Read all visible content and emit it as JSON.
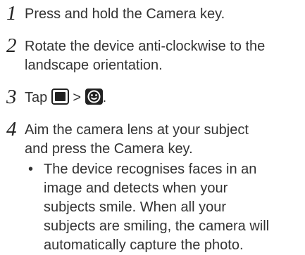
{
  "steps": [
    {
      "number": "1",
      "lines": [
        "Press and hold the Camera key."
      ]
    },
    {
      "number": "2",
      "lines": [
        "Rotate the device anti-clockwise to the",
        "landscape orientation."
      ]
    },
    {
      "number": "3",
      "prefix": "Tap",
      "separator": ">",
      "suffix": ".",
      "icons": [
        "camera-mode-box-icon",
        "smile-shot-icon"
      ]
    },
    {
      "number": "4",
      "lines": [
        "Aim the camera lens at your subject",
        "and press the Camera key."
      ]
    }
  ],
  "bullet": {
    "symbol": "•",
    "lines": [
      "The device recognises faces in an",
      "image and detects when your",
      "subjects smile. When all your",
      "subjects are smiling, the camera will",
      "automatically capture the photo."
    ]
  }
}
